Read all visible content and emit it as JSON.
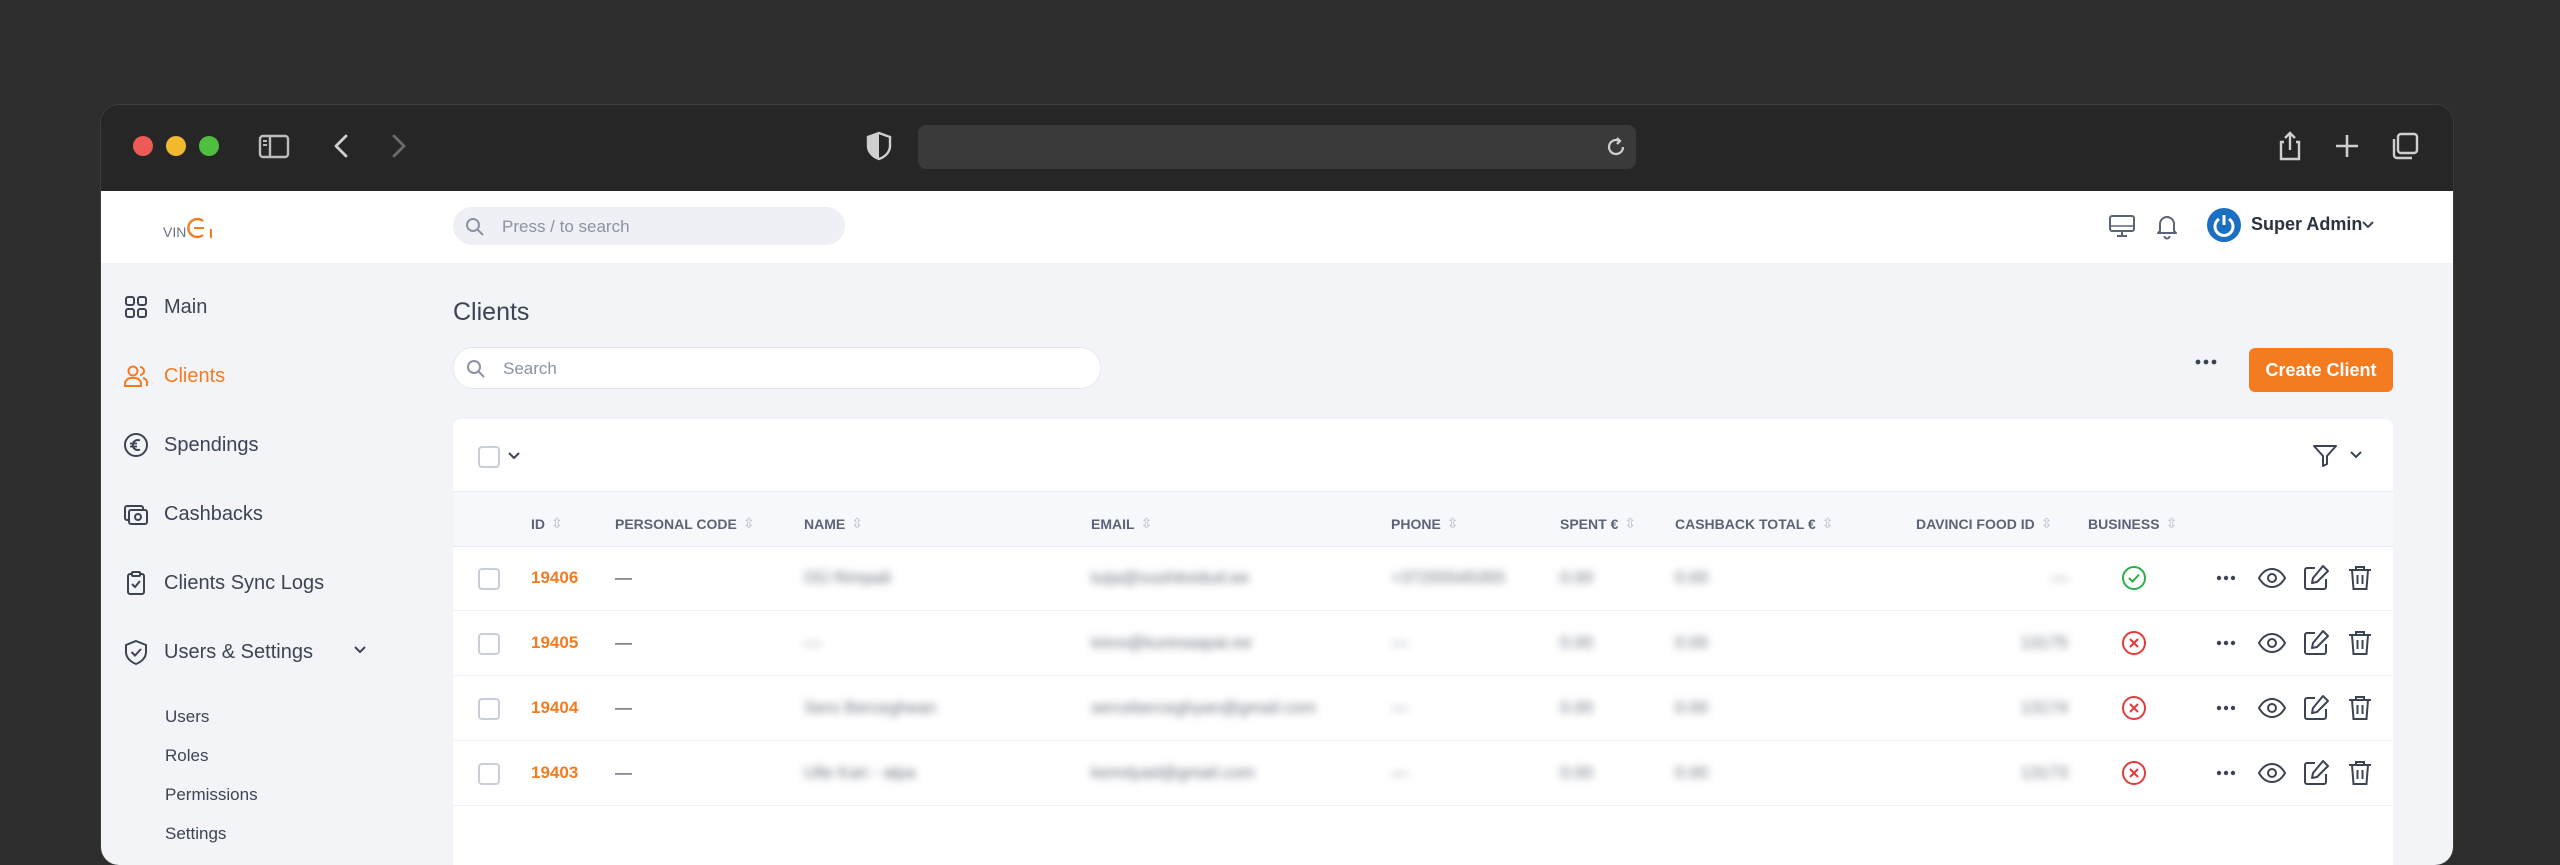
{
  "topbar": {
    "logo_text": "VINCI",
    "search_placeholder": "Press / to search",
    "user_name": "Super Admin"
  },
  "sidebar": {
    "items": [
      {
        "label": "Main",
        "icon": "grid-icon"
      },
      {
        "label": "Clients",
        "icon": "users-icon",
        "active": true
      },
      {
        "label": "Spendings",
        "icon": "euro-icon"
      },
      {
        "label": "Cashbacks",
        "icon": "cashback-icon"
      },
      {
        "label": "Clients Sync Logs",
        "icon": "clipboard-check-icon"
      },
      {
        "label": "Users & Settings",
        "icon": "shield-check-icon"
      }
    ],
    "subitems": [
      "Users",
      "Roles",
      "Permissions",
      "Settings"
    ]
  },
  "main": {
    "title": "Clients",
    "search_placeholder": "Search",
    "create_label": "Create Client"
  },
  "table": {
    "columns": [
      "ID",
      "PERSONAL CODE",
      "NAME",
      "EMAIL",
      "PHONE",
      "SPENT €",
      "CASHBACK TOTAL €",
      "DAVINCI FOOD ID",
      "BUSINESS"
    ],
    "rows": [
      {
        "id": "19406",
        "personal_code": "—",
        "name": "OÜ Rimpali",
        "email": "tuija@sushitoidud.ee",
        "phone": "+37255545355",
        "spent": "0.00",
        "cashback": "0.00",
        "food_id": "—",
        "business": true
      },
      {
        "id": "19405",
        "personal_code": "—",
        "name": "—",
        "email": "toivo@kuresaapar.ee",
        "phone": "—",
        "spent": "0.00",
        "cashback": "0.00",
        "food_id": "13175",
        "business": false
      },
      {
        "id": "19404",
        "personal_code": "—",
        "name": "Sero Berceghean",
        "email": "serceberceghyan@gmail.com",
        "phone": "—",
        "spent": "0.00",
        "cashback": "0.00",
        "food_id": "13174",
        "business": false
      },
      {
        "id": "19403",
        "personal_code": "—",
        "name": "Ulle Kari - alpa",
        "email": "kemdyad@gmail.com",
        "phone": "—",
        "spent": "0.00",
        "cashback": "0.00",
        "food_id": "13173",
        "business": false
      }
    ]
  },
  "colors": {
    "accent": "#f47b20",
    "success": "#2ead4b",
    "danger": "#e23b3b"
  }
}
